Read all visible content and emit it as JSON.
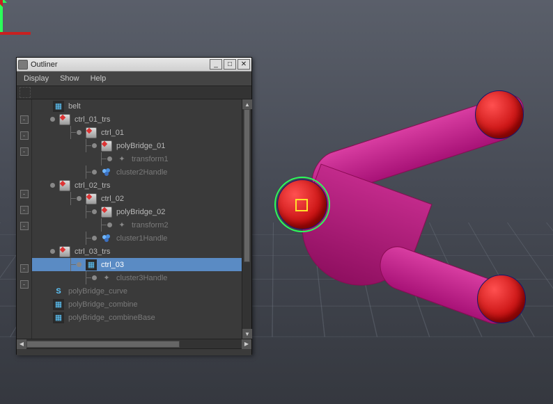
{
  "window": {
    "title": "Outliner",
    "min_label": "_",
    "max_label": "□",
    "close_label": "✕"
  },
  "menu": {
    "display": "Display",
    "show": "Show",
    "help": "Help"
  },
  "search": {
    "placeholder": ""
  },
  "scroll": {
    "up": "▲",
    "down": "▼",
    "left": "◀",
    "right": "▶"
  },
  "tree": [
    {
      "depth": 0,
      "icon": "mesh",
      "label": "belt",
      "gutter": "",
      "selected": false,
      "dim": false,
      "dot": false
    },
    {
      "depth": 0,
      "icon": "grp",
      "label": "ctrl_01_trs",
      "gutter": "-",
      "selected": false,
      "dim": false,
      "dot": true
    },
    {
      "depth": 1,
      "icon": "grp",
      "label": "ctrl_01",
      "gutter": "-",
      "selected": false,
      "dim": false,
      "dot": true
    },
    {
      "depth": 2,
      "icon": "grp",
      "label": "polyBridge_01",
      "gutter": "-",
      "selected": false,
      "dim": false,
      "dot": true
    },
    {
      "depth": 3,
      "icon": "xform",
      "label": "transform1",
      "gutter": "",
      "selected": false,
      "dim": true,
      "dot": true
    },
    {
      "depth": 2,
      "icon": "cluster",
      "label": "cluster2Handle",
      "gutter": "",
      "selected": false,
      "dim": true,
      "dot": true
    },
    {
      "depth": 0,
      "icon": "grp",
      "label": "ctrl_02_trs",
      "gutter": "-",
      "selected": false,
      "dim": false,
      "dot": true
    },
    {
      "depth": 1,
      "icon": "grp",
      "label": "ctrl_02",
      "gutter": "-",
      "selected": false,
      "dim": false,
      "dot": true
    },
    {
      "depth": 2,
      "icon": "grp",
      "label": "polyBridge_02",
      "gutter": "-",
      "selected": false,
      "dim": false,
      "dot": true
    },
    {
      "depth": 3,
      "icon": "xform",
      "label": "transform2",
      "gutter": "",
      "selected": false,
      "dim": true,
      "dot": true
    },
    {
      "depth": 2,
      "icon": "cluster",
      "label": "cluster1Handle",
      "gutter": "",
      "selected": false,
      "dim": true,
      "dot": true
    },
    {
      "depth": 0,
      "icon": "grp",
      "label": "ctrl_03_trs",
      "gutter": "-",
      "selected": false,
      "dim": false,
      "dot": true
    },
    {
      "depth": 1,
      "icon": "mesh",
      "label": "ctrl_03",
      "gutter": "-",
      "selected": true,
      "dim": false,
      "dot": true
    },
    {
      "depth": 2,
      "icon": "xform",
      "label": "cluster3Handle",
      "gutter": "",
      "selected": false,
      "dim": true,
      "dot": true
    },
    {
      "depth": 0,
      "icon": "curve",
      "label": "polyBridge_curve",
      "gutter": "",
      "selected": false,
      "dim": true,
      "dot": false
    },
    {
      "depth": 0,
      "icon": "mesh",
      "label": "polyBridge_combine",
      "gutter": "",
      "selected": false,
      "dim": true,
      "dot": false
    },
    {
      "depth": 0,
      "icon": "mesh",
      "label": "polyBridge_combineBase",
      "gutter": "",
      "selected": false,
      "dim": true,
      "dot": false
    }
  ]
}
